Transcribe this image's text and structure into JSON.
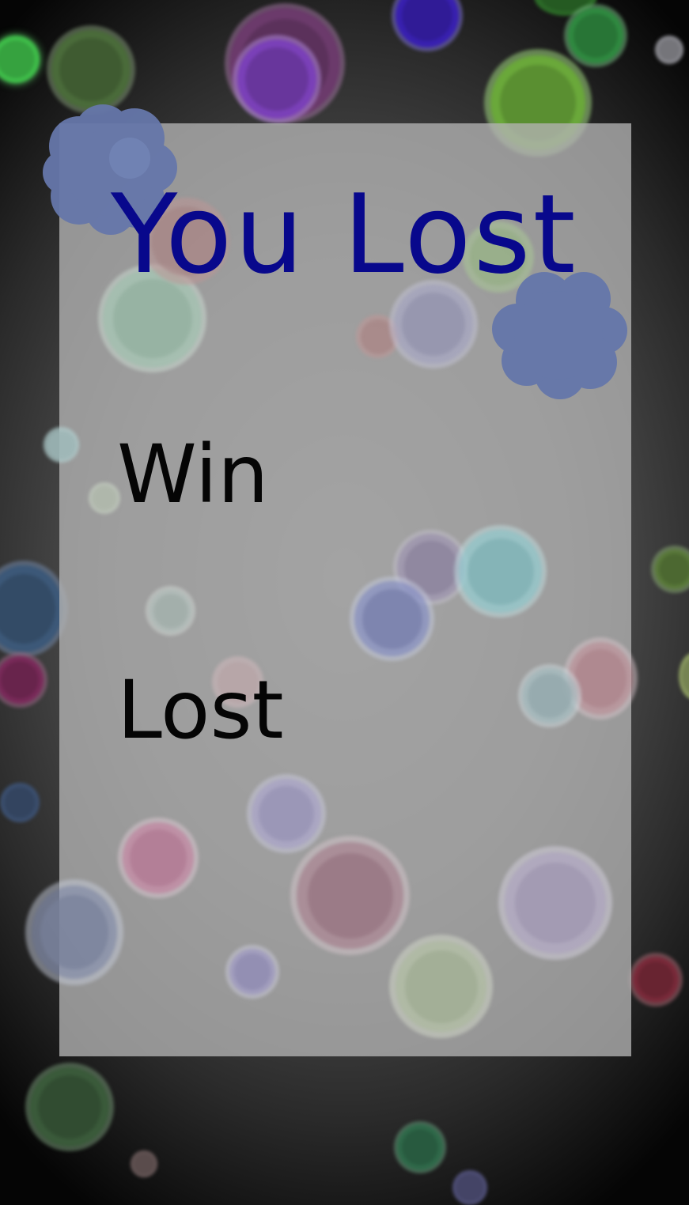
{
  "screen": {
    "title": "You Lost",
    "menu": [
      {
        "id": "win",
        "label": "Win"
      },
      {
        "id": "lost",
        "label": "Lost"
      }
    ]
  },
  "colors": {
    "title": "#08088c",
    "option_text": "#050505",
    "panel": "#b4b4b4",
    "blob": "#6677aa"
  }
}
